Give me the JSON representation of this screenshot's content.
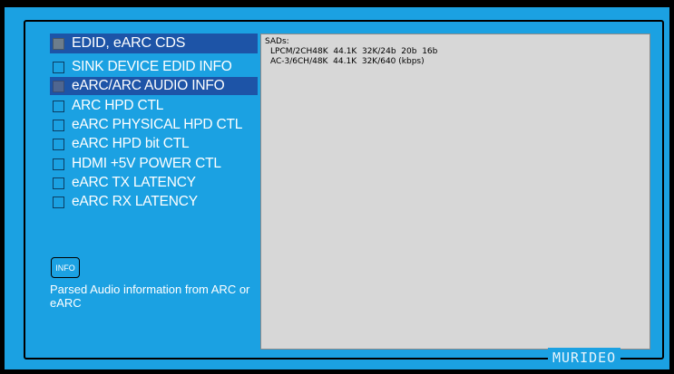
{
  "menu": {
    "title": "EDID, eARC CDS",
    "items": [
      {
        "label": "SINK DEVICE EDID INFO",
        "selected": false
      },
      {
        "label": "eARC/ARC AUDIO INFO",
        "selected": true
      },
      {
        "label": "ARC HPD CTL",
        "selected": false
      },
      {
        "label": "eARC PHYSICAL HPD CTL",
        "selected": false
      },
      {
        "label": "eARC HPD bit CTL",
        "selected": false
      },
      {
        "label": "HDMI +5V POWER CTL",
        "selected": false
      },
      {
        "label": "eARC TX LATENCY",
        "selected": false
      },
      {
        "label": "eARC RX LATENCY",
        "selected": false
      }
    ]
  },
  "info_button": {
    "label": "INFO"
  },
  "description": "Parsed Audio information from ARC or eARC",
  "info_panel": {
    "heading": "SADs:",
    "lines": [
      "LPCM/2CH48K  44.1K  32K/24b  20b  16b",
      "AC-3/6CH/48K  44.1K  32K/640 (kbps)"
    ]
  },
  "brand": "MURIDEO",
  "colors": {
    "background": "#1ba1e2",
    "selection": "#1d54a7",
    "panel": "#d7d7d7"
  }
}
